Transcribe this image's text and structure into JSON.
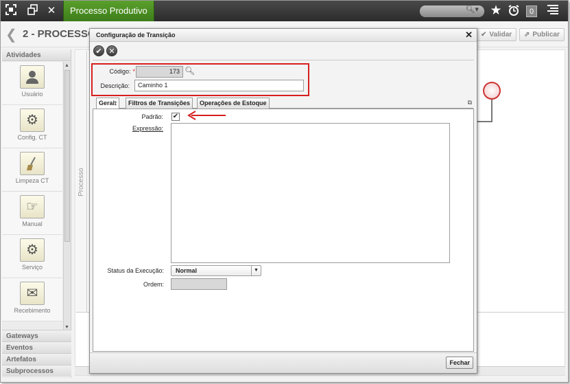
{
  "topbar": {
    "app_tab": "Processo Produtivo",
    "notification_count": "0",
    "icons": [
      "fullscreen-icon",
      "restore-window-icon",
      "close-icon",
      "search-icon",
      "star-icon",
      "alarm-clock-icon",
      "menu-icon"
    ]
  },
  "page": {
    "title": "2 - PROCESSO",
    "buttons": {
      "validate": "Validar",
      "publish": "Publicar"
    }
  },
  "left_panel": {
    "header": "Atividades",
    "items": [
      {
        "label": "Usuário",
        "icon": "user-icon"
      },
      {
        "label": "Config. CT",
        "icon": "gear-icon"
      },
      {
        "label": "Limpeza CT",
        "icon": "broom-icon"
      },
      {
        "label": "Manual",
        "icon": "hand-icon"
      },
      {
        "label": "Serviço",
        "icon": "gears-icon"
      },
      {
        "label": "Recebimento",
        "icon": "envelope-icon"
      }
    ],
    "sections": [
      "Gateways",
      "Eventos",
      "Artefatos",
      "Subprocessos"
    ]
  },
  "canvas": {
    "lane_label": "Processo"
  },
  "modal": {
    "title": "Configuração de Transição",
    "codigo_label": "Código:",
    "codigo_value": "173",
    "descricao_label": "Descrição:",
    "descricao_value": "Caminho 1",
    "tabs": [
      "Geral",
      "Filtros de Transições",
      "Operações de Estoque"
    ],
    "padrao_label": "Padrão:",
    "padrao_checked": true,
    "expressao_label": "Expressão:",
    "expressao_value": "",
    "status_label": "Status da Execução:",
    "status_value": "Normal",
    "ordem_label": "Ordem:",
    "ordem_value": "",
    "close_button": "Fechar"
  },
  "colors": {
    "app_tab_green": "#4a8f22",
    "highlight_red": "#d61f1f"
  }
}
